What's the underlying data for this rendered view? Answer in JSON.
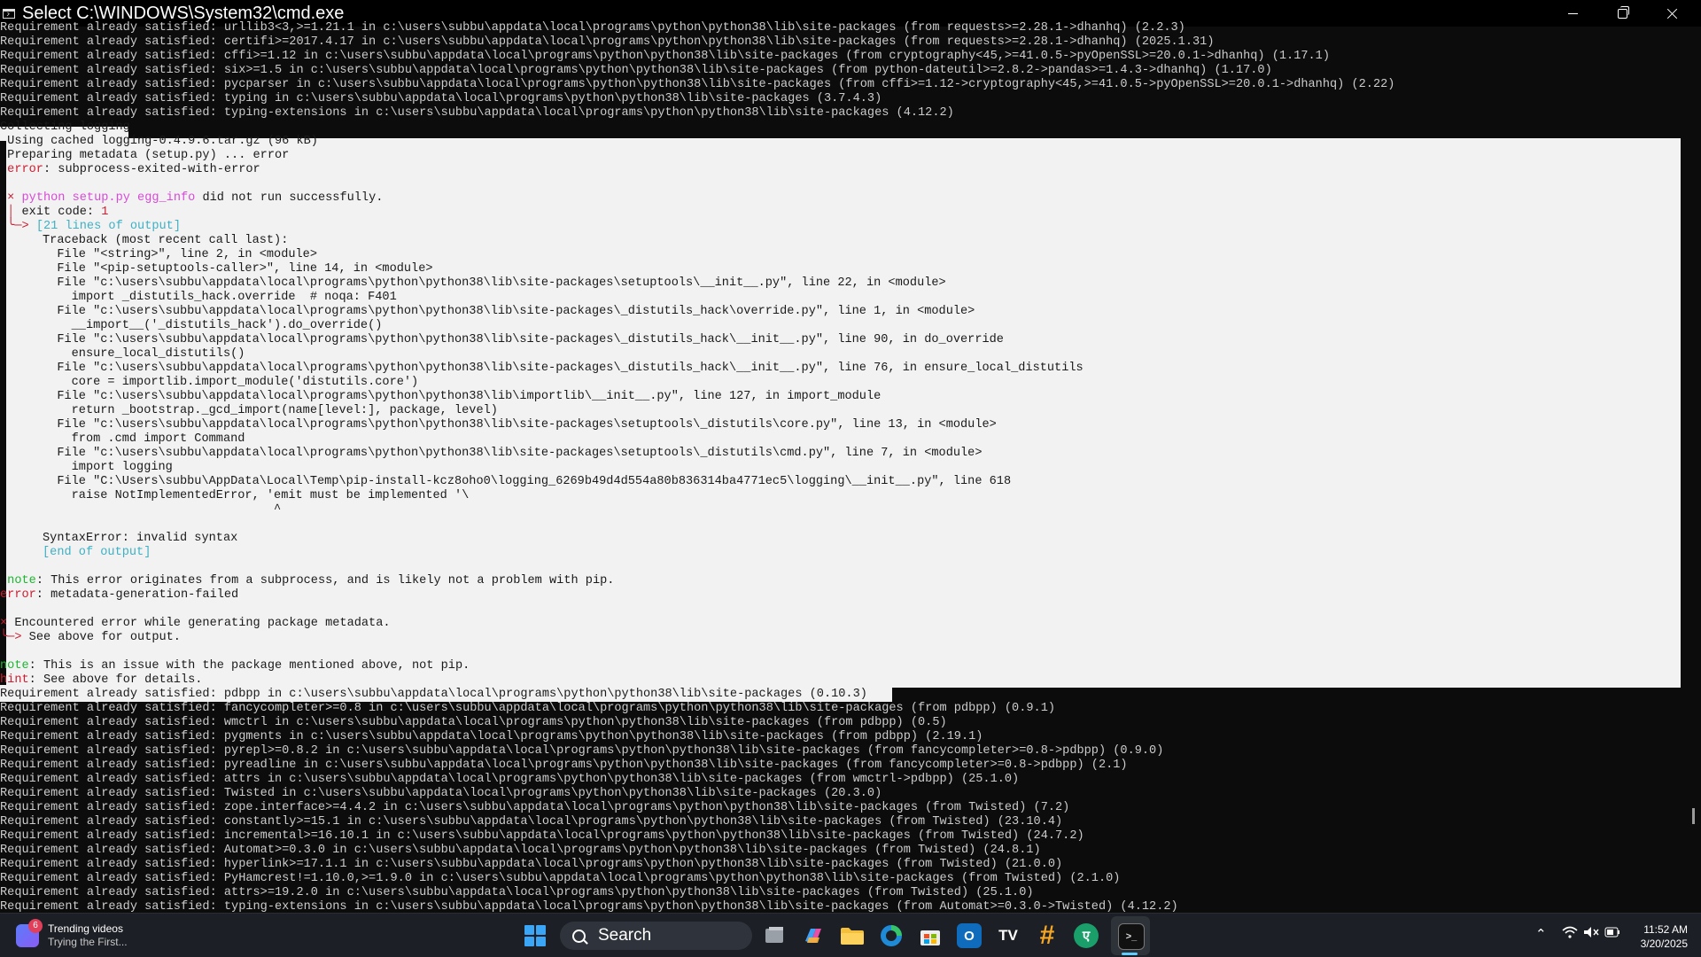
{
  "window": {
    "title": "Select C:\\WINDOWS\\System32\\cmd.exe"
  },
  "console_lines_top": [
    "Requirement already satisfied: urllib3<3,>=1.21.1 in c:\\users\\subbu\\appdata\\local\\programs\\python\\python38\\lib\\site-packages (from requests>=2.28.1->dhanhq) (2.2.3)",
    "Requirement already satisfied: certifi>=2017.4.17 in c:\\users\\subbu\\appdata\\local\\programs\\python\\python38\\lib\\site-packages (from requests>=2.28.1->dhanhq) (2025.1.31)",
    "Requirement already satisfied: cffi>=1.12 in c:\\users\\subbu\\appdata\\local\\programs\\python\\python38\\lib\\site-packages (from cryptography<45,>=41.0.5->pyOpenSSL>=20.0.1->dhanhq) (1.17.1)",
    "Requirement already satisfied: six>=1.5 in c:\\users\\subbu\\appdata\\local\\programs\\python\\python38\\lib\\site-packages (from python-dateutil>=2.8.2->pandas>=1.4.3->dhanhq) (1.17.0)",
    "Requirement already satisfied: pycparser in c:\\users\\subbu\\appdata\\local\\programs\\python\\python38\\lib\\site-packages (from cffi>=1.12->cryptography<45,>=41.0.5->pyOpenSSL>=20.0.1->dhanhq) (2.22)",
    "Requirement already satisfied: typing in c:\\users\\subbu\\appdata\\local\\programs\\python\\python38\\lib\\site-packages (3.7.4.3)",
    "Requirement already satisfied: typing-extensions in c:\\users\\subbu\\appdata\\local\\programs\\python\\python38\\lib\\site-packages (4.12.2)"
  ],
  "collecting": "Collecting logging",
  "error_block": {
    "cached": " Using cached logging-0.4.9.6.tar.gz (96 kB)",
    "preparing": " Preparing metadata (setup.py) ... error",
    "err_label": "error",
    "err_text": ": subprocess-exited-with-error",
    "x_mark": "×",
    "cmd_python": "python setup.py egg_info",
    "cmd_rest": " did not run successfully.",
    "exit_branch": "│",
    "exit_label": " exit code: ",
    "exit_code": "1",
    "lines_branch": "╰─>",
    "lines_count": " [21 lines of output]",
    "traceback": [
      "Traceback (most recent call last):",
      "  File \"<string>\", line 2, in <module>",
      "  File \"<pip-setuptools-caller>\", line 14, in <module>",
      "  File \"c:\\users\\subbu\\appdata\\local\\programs\\python\\python38\\lib\\site-packages\\setuptools\\__init__.py\", line 22, in <module>",
      "    import _distutils_hack.override  # noqa: F401",
      "  File \"c:\\users\\subbu\\appdata\\local\\programs\\python\\python38\\lib\\site-packages\\_distutils_hack\\override.py\", line 1, in <module>",
      "    __import__('_distutils_hack').do_override()",
      "  File \"c:\\users\\subbu\\appdata\\local\\programs\\python\\python38\\lib\\site-packages\\_distutils_hack\\__init__.py\", line 90, in do_override",
      "    ensure_local_distutils()",
      "  File \"c:\\users\\subbu\\appdata\\local\\programs\\python\\python38\\lib\\site-packages\\_distutils_hack\\__init__.py\", line 76, in ensure_local_distutils",
      "    core = importlib.import_module('distutils.core')",
      "  File \"c:\\users\\subbu\\appdata\\local\\programs\\python\\python38\\lib\\importlib\\__init__.py\", line 127, in import_module",
      "    return _bootstrap._gcd_import(name[level:], package, level)",
      "  File \"c:\\users\\subbu\\appdata\\local\\programs\\python\\python38\\lib\\site-packages\\setuptools\\_distutils\\core.py\", line 13, in <module>",
      "    from .cmd import Command",
      "  File \"c:\\users\\subbu\\appdata\\local\\programs\\python\\python38\\lib\\site-packages\\setuptools\\_distutils\\cmd.py\", line 7, in <module>",
      "    import logging",
      "  File \"C:\\Users\\subbu\\AppData\\Local\\Temp\\pip-install-kcz8oho0\\logging_6269b49d4d554a80b836314ba4771ec5\\logging\\__init__.py\", line 618",
      "    raise NotImplementedError, 'emit must be implemented '\\",
      "                                ^",
      "",
      "SyntaxError: invalid syntax"
    ],
    "end_output": "[end of output]",
    "note1_label": "note",
    "note1_text": ": This error originates from a subprocess, and is likely not a problem with pip.",
    "meta_err_label": "error",
    "meta_err_text": ": metadata-generation-failed",
    "encountered": " Encountered error while generating package metadata.",
    "see_above": " See above for output.",
    "note2_label": "note",
    "note2_text": ": This is an issue with the package mentioned above, not pip.",
    "hint_label": "hint",
    "hint_text": ": See above for details."
  },
  "pdbpp_line": "Requirement already satisfied: pdbpp in c:\\users\\subbu\\appdata\\local\\programs\\python\\python38\\lib\\site-packages (0.10.3)",
  "console_lines_bottom": [
    "Requirement already satisfied: fancycompleter>=0.8 in c:\\users\\subbu\\appdata\\local\\programs\\python\\python38\\lib\\site-packages (from pdbpp) (0.9.1)",
    "Requirement already satisfied: wmctrl in c:\\users\\subbu\\appdata\\local\\programs\\python\\python38\\lib\\site-packages (from pdbpp) (0.5)",
    "Requirement already satisfied: pygments in c:\\users\\subbu\\appdata\\local\\programs\\python\\python38\\lib\\site-packages (from pdbpp) (2.19.1)",
    "Requirement already satisfied: pyrepl>=0.8.2 in c:\\users\\subbu\\appdata\\local\\programs\\python\\python38\\lib\\site-packages (from fancycompleter>=0.8->pdbpp) (0.9.0)",
    "Requirement already satisfied: pyreadline in c:\\users\\subbu\\appdata\\local\\programs\\python\\python38\\lib\\site-packages (from fancycompleter>=0.8->pdbpp) (2.1)",
    "Requirement already satisfied: attrs in c:\\users\\subbu\\appdata\\local\\programs\\python\\python38\\lib\\site-packages (from wmctrl->pdbpp) (25.1.0)",
    "Requirement already satisfied: Twisted in c:\\users\\subbu\\appdata\\local\\programs\\python\\python38\\lib\\site-packages (20.3.0)",
    "Requirement already satisfied: zope.interface>=4.4.2 in c:\\users\\subbu\\appdata\\local\\programs\\python\\python38\\lib\\site-packages (from Twisted) (7.2)",
    "Requirement already satisfied: constantly>=15.1 in c:\\users\\subbu\\appdata\\local\\programs\\python\\python38\\lib\\site-packages (from Twisted) (23.10.4)",
    "Requirement already satisfied: incremental>=16.10.1 in c:\\users\\subbu\\appdata\\local\\programs\\python\\python38\\lib\\site-packages (from Twisted) (24.7.2)",
    "Requirement already satisfied: Automat>=0.3.0 in c:\\users\\subbu\\appdata\\local\\programs\\python\\python38\\lib\\site-packages (from Twisted) (24.8.1)",
    "Requirement already satisfied: hyperlink>=17.1.1 in c:\\users\\subbu\\appdata\\local\\programs\\python\\python38\\lib\\site-packages (from Twisted) (21.0.0)",
    "Requirement already satisfied: PyHamcrest!=1.10.0,>=1.9.0 in c:\\users\\subbu\\appdata\\local\\programs\\python\\python38\\lib\\site-packages (from Twisted) (2.1.0)",
    "Requirement already satisfied: attrs>=19.2.0 in c:\\users\\subbu\\appdata\\local\\programs\\python\\python38\\lib\\site-packages (from Twisted) (25.1.0)",
    "Requirement already satisfied: typing-extensions in c:\\users\\subbu\\appdata\\local\\programs\\python\\python38\\lib\\site-packages (from Automat>=0.3.0->Twisted) (4.12.2)"
  ],
  "taskbar": {
    "widget_title": "Trending videos",
    "widget_sub": "Trying the First...",
    "widget_badge": "6",
    "search_label": "Search",
    "time": "11:52 AM",
    "date": "3/20/2025"
  },
  "colors": {
    "console_bg": "#0c0c0c",
    "selection_bg": "#f2f2f2",
    "error_red": "#c81f32",
    "note_green": "#13a10e",
    "magenta": "#d64bd6",
    "cyan": "#3fb0c4",
    "taskbar_bg": "#1c1f25"
  }
}
